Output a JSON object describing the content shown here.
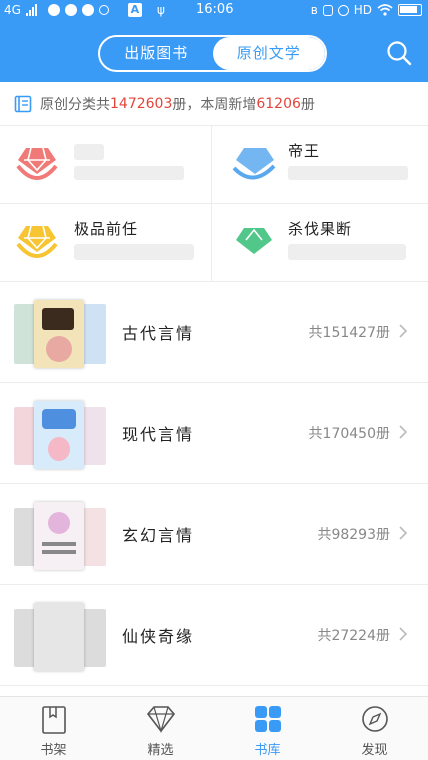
{
  "status_bar": {
    "network": "4G",
    "time": "16:06",
    "hd": "HD",
    "app_badge": "A"
  },
  "header": {
    "tabs": [
      {
        "label": "出版图书",
        "active": false
      },
      {
        "label": "原创文学",
        "active": true
      }
    ],
    "accent_color": "#3a9bf7"
  },
  "info": {
    "prefix": "原创分类共",
    "total": "1472603",
    "middle": "册，本周新增",
    "weekly": "61206",
    "suffix": "册"
  },
  "rank_grid": [
    {
      "label": "",
      "icon": "crown-icon",
      "color": "#f07a77"
    },
    {
      "label": "帝王",
      "icon": "crown-icon",
      "color": "#5aa9ee"
    },
    {
      "label": "极品前任",
      "icon": "crown-icon",
      "color": "#f6c531"
    },
    {
      "label": "杀伐果断",
      "icon": "crown-icon",
      "color": "#3ec17d"
    }
  ],
  "categories": [
    {
      "title": "古代言情",
      "count": "共151427册"
    },
    {
      "title": "现代言情",
      "count": "共170450册"
    },
    {
      "title": "玄幻言情",
      "count": "共98293册"
    },
    {
      "title": "仙侠奇缘",
      "count": "共27224册"
    }
  ],
  "bottom_nav": [
    {
      "label": "书架",
      "icon": "bookmark-book-icon",
      "active": false
    },
    {
      "label": "精选",
      "icon": "diamond-icon",
      "active": false
    },
    {
      "label": "书库",
      "icon": "grid-icon",
      "active": true
    },
    {
      "label": "发现",
      "icon": "compass-icon",
      "active": false
    }
  ]
}
